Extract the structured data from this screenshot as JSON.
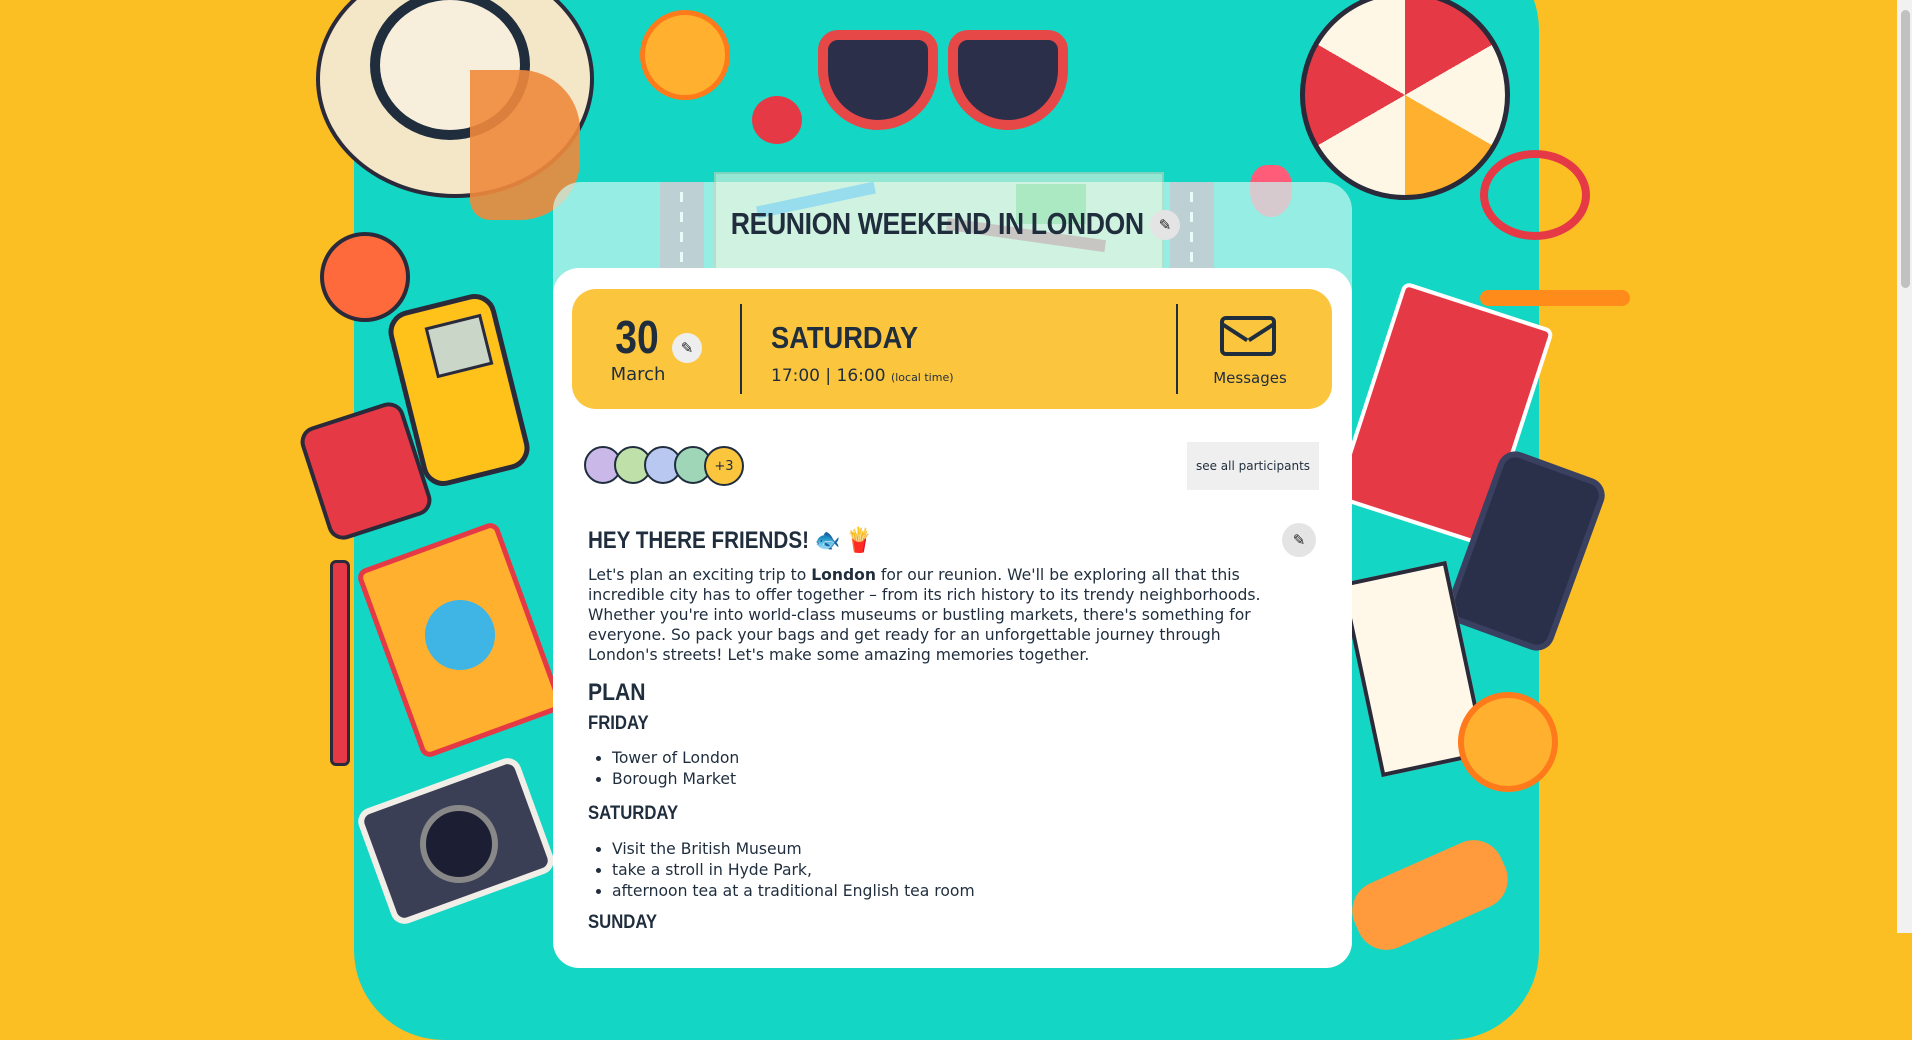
{
  "event": {
    "title": "REUNION WEEKEND IN LONDON",
    "day": "30",
    "month": "March",
    "weekday": "SATURDAY",
    "times": "17:00 | 16:00",
    "times_note": "(local time)",
    "messages_label": "Messages"
  },
  "participants": {
    "more_count": "+3",
    "see_all_label": "see all participants"
  },
  "description": {
    "heading": "HEY THERE FRIENDS! 🐟 🍟",
    "intro_before": "Let's plan an exciting trip to ",
    "intro_bold": "London",
    "intro_after": " for our reunion. We'll be exploring all that this incredible city has to offer together – from its rich history to its trendy neighborhoods. Whether you're into world-class museums or bustling markets, there's something for everyone. So pack your bags and get ready for an unforgettable journey through London's streets! Let's make some amazing memories together.",
    "plan_heading": "PLAN",
    "days": [
      {
        "name": "FRIDAY",
        "items": [
          "Tower of London",
          "Borough Market"
        ]
      },
      {
        "name": "SATURDAY",
        "items": [
          "Visit the British Museum",
          "take a stroll in Hyde Park,",
          "afternoon tea at a traditional English tea room"
        ]
      },
      {
        "name": "SUNDAY",
        "items": []
      }
    ]
  },
  "colors": {
    "background": "#fbbf24",
    "panel": "#13d6c4",
    "datebar": "#fcc53e",
    "text": "#1f2d3d"
  },
  "icons": {
    "edit": "pencil-icon",
    "messages": "envelope-icon"
  }
}
